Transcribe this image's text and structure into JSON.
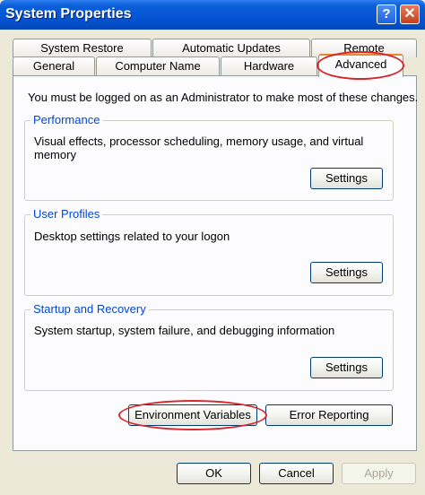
{
  "window": {
    "title": "System Properties",
    "help_label": "?",
    "close_label": "✕"
  },
  "tabs": {
    "back_row": [
      "System Restore",
      "Automatic Updates",
      "Remote"
    ],
    "front_row": [
      "General",
      "Computer Name",
      "Hardware",
      "Advanced"
    ],
    "selected": "Advanced"
  },
  "panel": {
    "intro": "You must be logged on as an Administrator to make most of these changes.",
    "performance": {
      "title": "Performance",
      "description": "Visual effects, processor scheduling, memory usage, and virtual memory",
      "button": "Settings"
    },
    "user_profiles": {
      "title": "User Profiles",
      "description": "Desktop settings related to your logon",
      "button": "Settings"
    },
    "startup_recovery": {
      "title": "Startup and Recovery",
      "description": "System startup, system failure, and debugging information",
      "button": "Settings"
    },
    "environment_variables_button": "Environment Variables",
    "error_reporting_button": "Error Reporting"
  },
  "footer": {
    "ok": "OK",
    "cancel": "Cancel",
    "apply": "Apply"
  },
  "annotations": {
    "highlight_color": "#d8262b"
  }
}
